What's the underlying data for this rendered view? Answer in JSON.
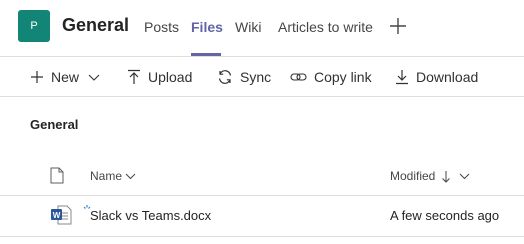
{
  "team": {
    "avatar_letter": "P",
    "avatar_color": "#138577",
    "channel_name": "General"
  },
  "tabs": [
    {
      "label": "Posts",
      "active": false
    },
    {
      "label": "Files",
      "active": true
    },
    {
      "label": "Wiki",
      "active": false
    },
    {
      "label": "Articles to write",
      "active": false
    }
  ],
  "add_tab_icon": "plus-icon",
  "accent_color": "#6264a7",
  "toolbar": {
    "new_label": "New",
    "upload_label": "Upload",
    "sync_label": "Sync",
    "copy_link_label": "Copy link",
    "download_label": "Download"
  },
  "breadcrumb": "General",
  "table": {
    "columns": {
      "file_type_icon": "document-icon",
      "name": "Name",
      "modified": "Modified"
    },
    "sort": {
      "column": "Modified",
      "direction": "descending"
    },
    "rows": [
      {
        "icon": "word-file-icon",
        "name": "Slack vs Teams.docx",
        "modified": "A few seconds ago"
      }
    ]
  }
}
